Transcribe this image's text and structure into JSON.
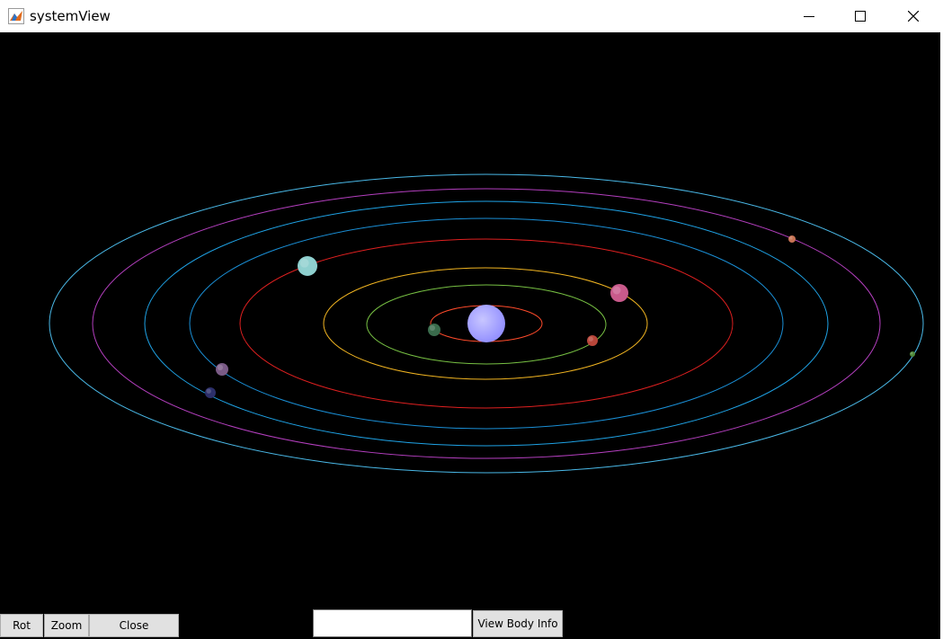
{
  "window": {
    "title": "systemView",
    "icon": "matlab-figure-icon",
    "controls": [
      "minimize-icon",
      "maximize-icon",
      "close-icon"
    ]
  },
  "controls": {
    "rot_label": "Rot",
    "zoom_label": "Zoom",
    "close_label": "Close",
    "body_input_value": "",
    "view_body_info_label": "View Body Info"
  },
  "scene": {
    "background": "#000000",
    "sun_color": "#a8a6ff",
    "orbits": [
      {
        "name": "orbit-1",
        "color": "#ff4b2b"
      },
      {
        "name": "orbit-2",
        "color": "#77c043"
      },
      {
        "name": "orbit-3",
        "color": "#f2b521"
      },
      {
        "name": "orbit-4",
        "color": "#e02020"
      },
      {
        "name": "orbit-5",
        "color": "#1a8fd6"
      },
      {
        "name": "orbit-6",
        "color": "#1fa3e6"
      },
      {
        "name": "orbit-7",
        "color": "#b43fbf"
      },
      {
        "name": "orbit-8",
        "color": "#4ab9e8"
      }
    ],
    "planets": [
      {
        "name": "planet-1",
        "color": "#3a6b4c"
      },
      {
        "name": "planet-2",
        "color": "#b8463a"
      },
      {
        "name": "planet-3",
        "color": "#c95a8b"
      },
      {
        "name": "planet-4",
        "color": "#8fd0cf"
      },
      {
        "name": "planet-5",
        "color": "#7a5b86"
      },
      {
        "name": "planet-6",
        "color": "#2c2f6a"
      },
      {
        "name": "planet-7",
        "color": "#c77354"
      },
      {
        "name": "planet-8",
        "color": "#4f8a3a"
      }
    ]
  }
}
